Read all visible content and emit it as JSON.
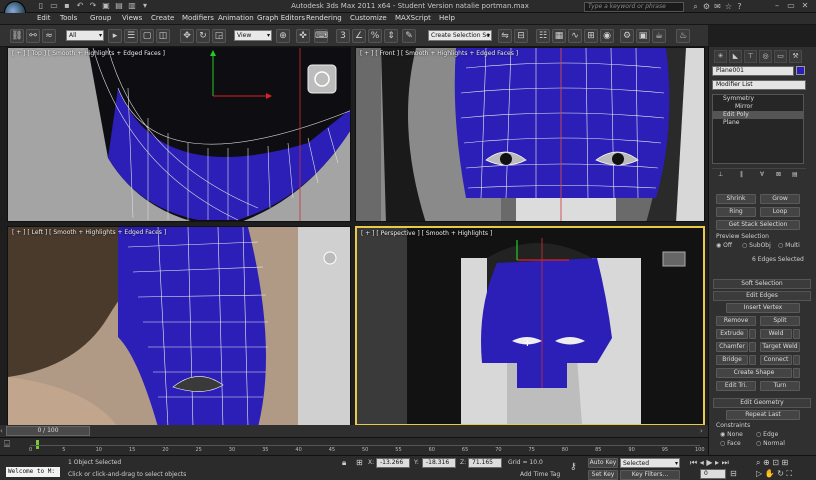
{
  "title": {
    "text": "Autodesk 3ds Max  2011 x64   - Student Version   natalie portman.max"
  },
  "search": {
    "placeholder": "Type a keyword or phrase"
  },
  "menu": [
    "Edit",
    "Tools",
    "Group",
    "Views",
    "Create",
    "Modifiers",
    "Animation",
    "Graph Editors",
    "Rendering",
    "Customize",
    "MAXScript",
    "Help"
  ],
  "toolbar": {
    "filter": "All",
    "refcoord": "View",
    "named_sel": "Create Selection Se"
  },
  "viewports": {
    "top": "[ + ] [ Top ] [ Smooth + Highlights + Edged Faces ]",
    "front": "[ + ] [ Front ] [ Smooth + Highlights + Edged Faces ]",
    "left": "[ + ] [ Left ] [ Smooth + Highlights + Edged Faces ]",
    "persp": "[ + ] [ Perspective ] [ Smooth + Highlights ]"
  },
  "panel": {
    "object_name": "Plane001",
    "modifier_list": "Modifier List",
    "stack": [
      "Symmetry",
      "Mirror",
      "Edit Poly",
      "Plane"
    ],
    "shrink": "Shrink",
    "grow": "Grow",
    "ring": "Ring",
    "loop": "Loop",
    "get_stack": "Get Stack Selection",
    "preview_sel": "Preview Selection",
    "off": "Off",
    "subobj": "SubObj",
    "multi": "Multi",
    "edges_selected": "6 Edges Selected",
    "soft_sel": "Soft Selection",
    "edit_edges": "Edit Edges",
    "insert_vertex": "Insert Vertex",
    "remove": "Remove",
    "split": "Split",
    "extrude": "Extrude",
    "weld": "Weld",
    "chamfer": "Chamfer",
    "target_weld": "Target Weld",
    "bridge": "Bridge",
    "connect": "Connect",
    "create_shape": "Create Shape",
    "edit_tri": "Edit Tri.",
    "turn": "Turn",
    "edit_geometry": "Edit Geometry",
    "repeat_last": "Repeat Last",
    "constraints": "Constraints",
    "none": "None",
    "edge": "Edge",
    "face": "Face",
    "normal": "Normal"
  },
  "timeline": {
    "frame": "0 / 100",
    "ticks": [
      "0",
      "5",
      "10",
      "15",
      "20",
      "25",
      "30",
      "35",
      "40",
      "45",
      "50",
      "55",
      "60",
      "65",
      "70",
      "75",
      "80",
      "85",
      "90",
      "95",
      "100"
    ]
  },
  "status": {
    "listener": "Welcome to M:",
    "selected": "1 Object Selected",
    "prompt": "Click or click-and-drag to select objects",
    "x_label": "X:",
    "x": "-13.266",
    "y_label": "Y:",
    "y": "-18.316",
    "z_label": "Z:",
    "z": "71.165",
    "grid": "Grid = 10.0",
    "add_time_tag": "Add Time Tag",
    "auto_key": "Auto Key",
    "set_key": "Set Key",
    "key_mode": "Selected",
    "key_filters": "Key Filters...",
    "frame_field": "0"
  },
  "colors": {
    "mesh_blue": "#2b1fb8",
    "active_border": "#e8c94a",
    "key_red": "#8a1e1e"
  }
}
